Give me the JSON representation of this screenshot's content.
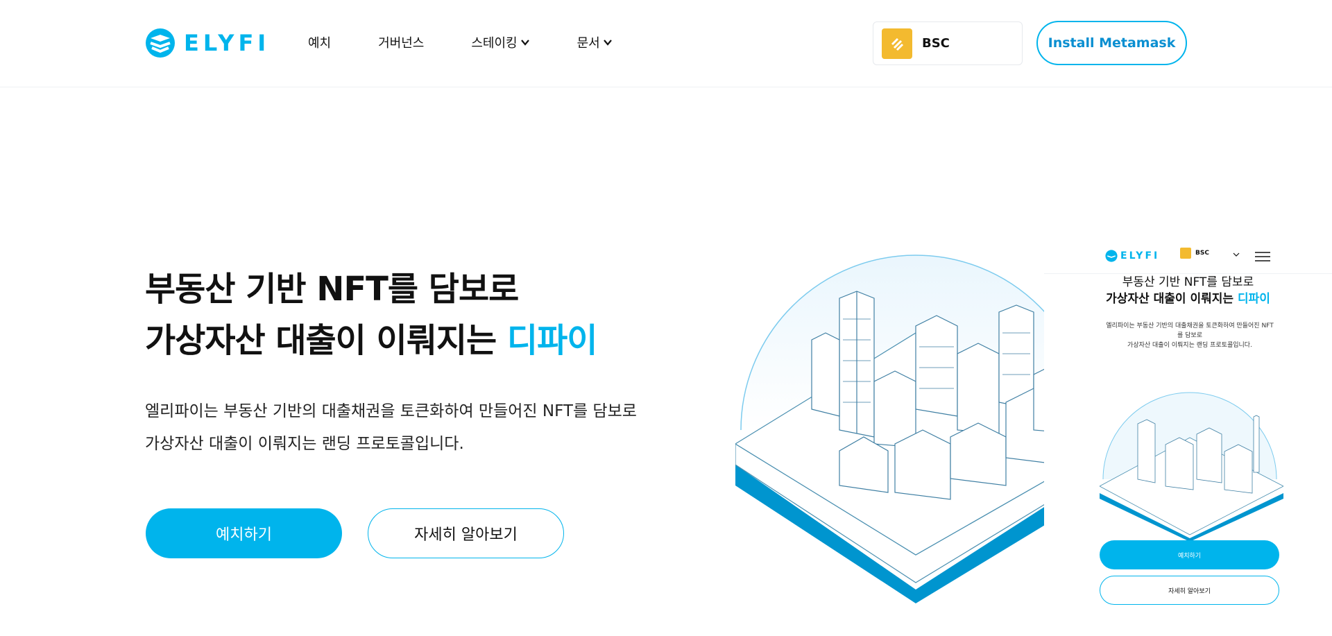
{
  "brand": {
    "name": "ELYFI"
  },
  "nav": {
    "items": [
      {
        "label": "예치"
      },
      {
        "label": "거버넌스"
      },
      {
        "label": "스테이킹"
      },
      {
        "label": "문서"
      }
    ]
  },
  "network": {
    "label": "BSC",
    "icon": "bnb-chain-icon",
    "color": "#f3ba2f"
  },
  "wallet": {
    "button_label": "Install Metamask"
  },
  "hero": {
    "title_line1": "부동산 기반 NFT를 담보로",
    "title_line2_prefix": "가상자산 대출이 이뤄지는 ",
    "title_line2_accent": "디파이",
    "desc_line1": "엘리파이는 부동산 기반의 대출채권을 토큰화하여 만들어진 NFT를 담보로",
    "desc_line2": "가상자산 대출이 이뤄지는 랜딩 프로토콜입니다.",
    "primary_button": "예치하기",
    "secondary_button": "자세히 알아보기"
  },
  "mobile_preview": {
    "brand": "ELYFI",
    "network": "BSC",
    "title_line1": "부동산 기반 NFT를 담보로",
    "title_line2_prefix": "가상자산 대출이 이뤄지는 ",
    "title_line2_accent": "디파이",
    "desc_line1": "엘리파이는 부동산 기반의 대출채권을 토큰화하여 만들어진 NFT",
    "desc_line2": "를 담보로",
    "desc_line3": "가상자산 대출이 이뤄지는 랜딩 프로토콜입니다.",
    "primary_button": "예치하기",
    "secondary_button": "자세히 알아보기"
  },
  "colors": {
    "accent": "#00b4ec",
    "link": "#0a8fd1",
    "dark_accent": "#0095cf"
  }
}
